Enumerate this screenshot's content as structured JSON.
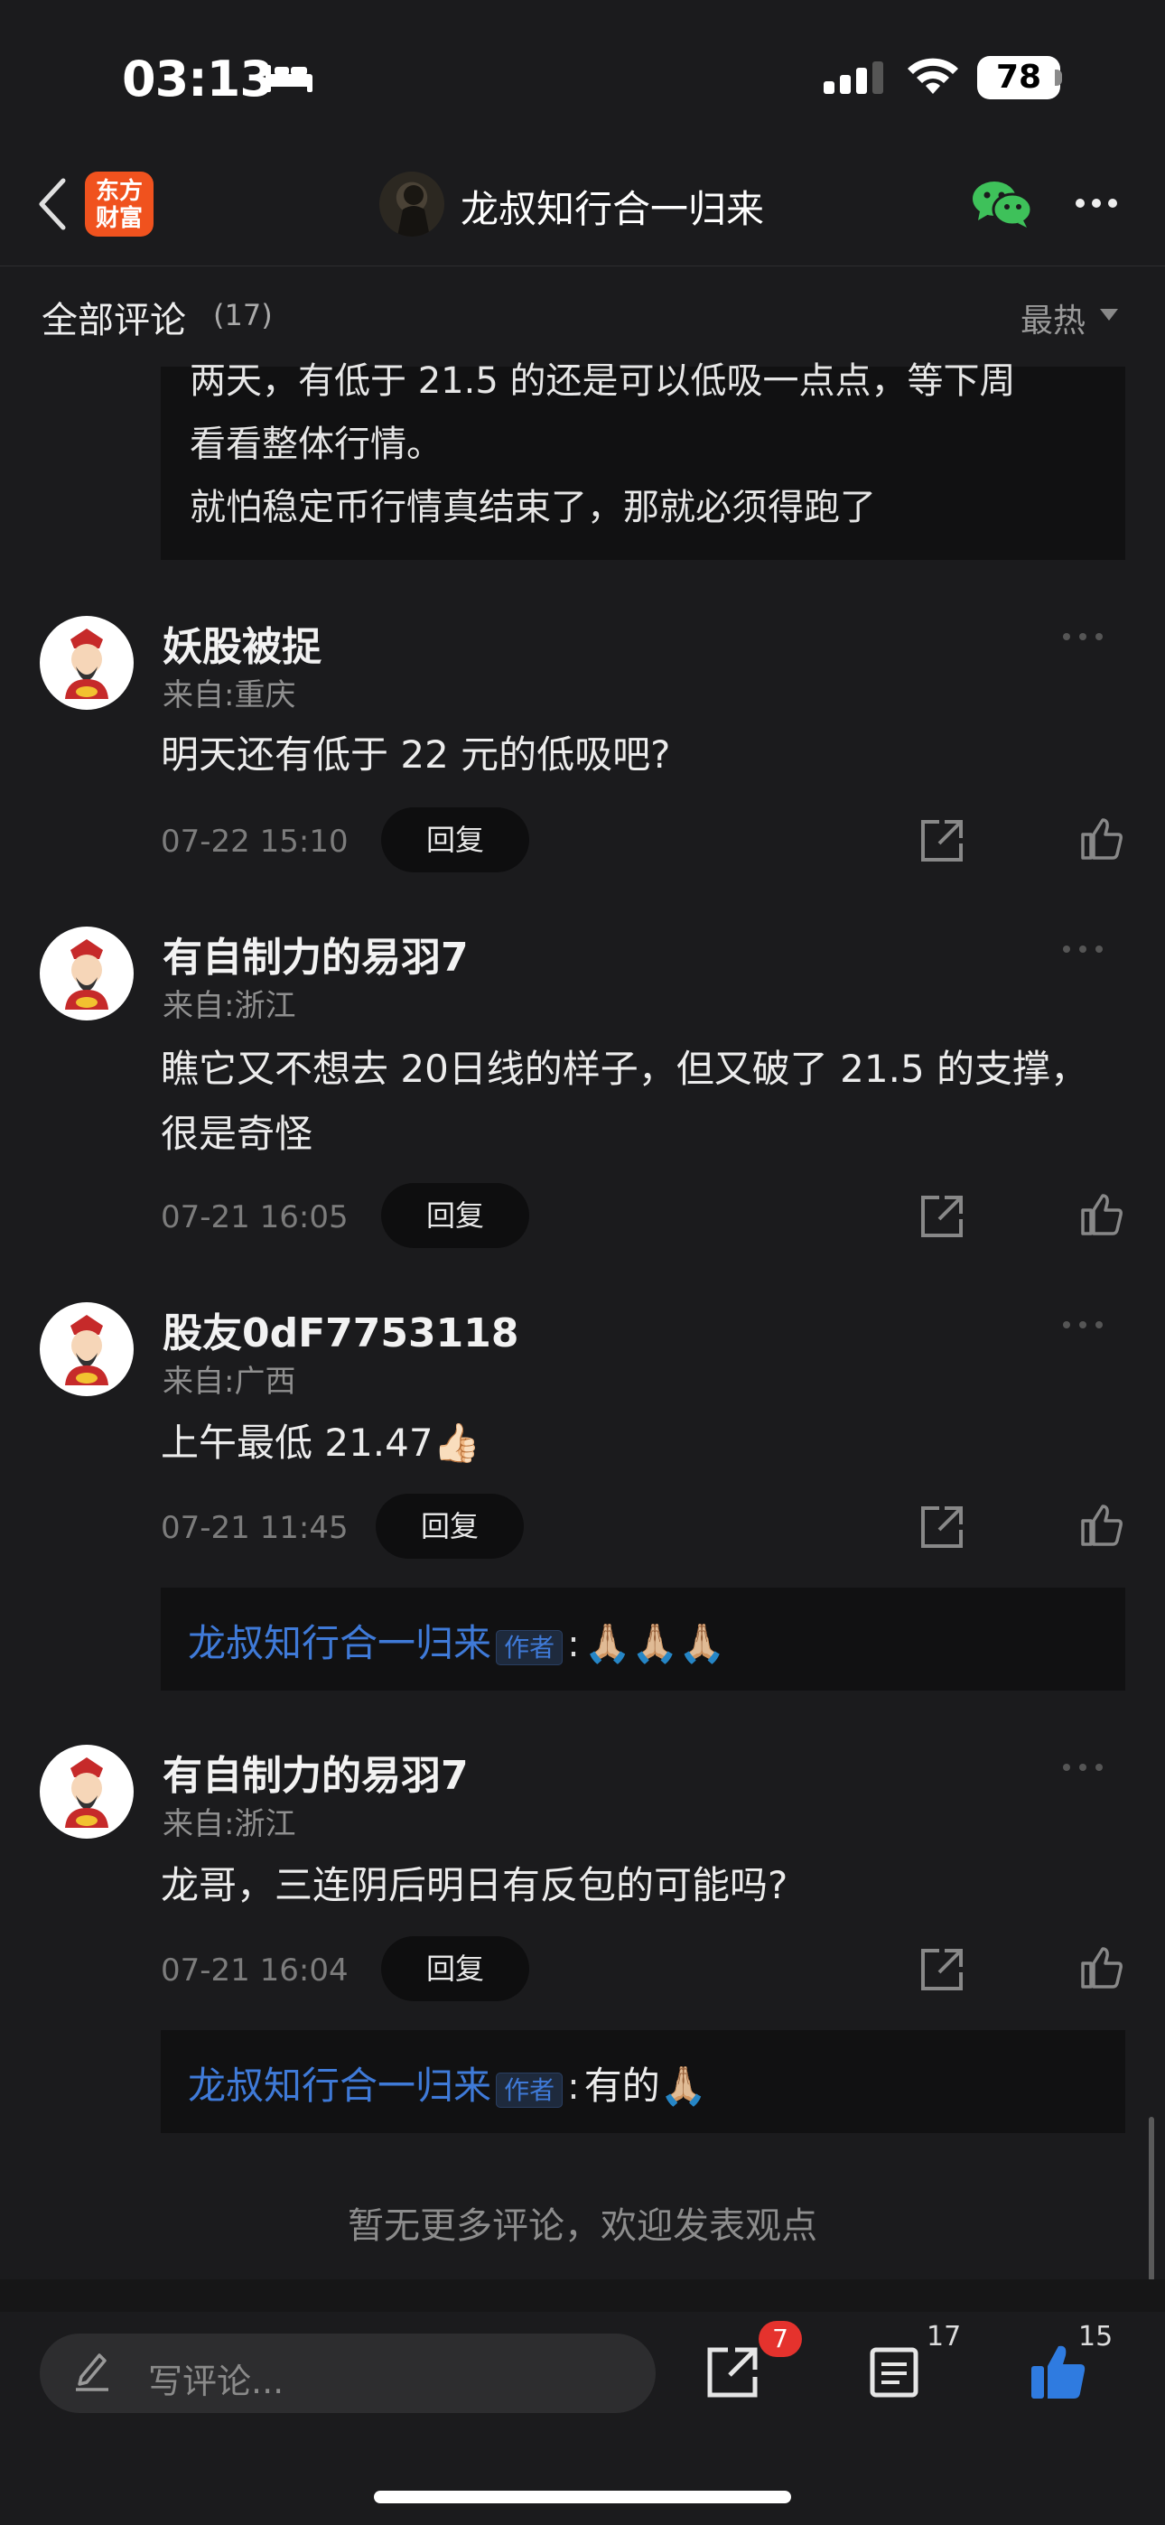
{
  "status": {
    "time": "03:13",
    "battery": "78"
  },
  "nav": {
    "logo_text": "东方\n财富",
    "title": "龙叔知行合一归来"
  },
  "header": {
    "title": "全部评论",
    "count": "(17)",
    "sort": "最热"
  },
  "quoted_top": {
    "lines": [
      "两天，有低于 21.5 的还是可以低吸一点点，等下周",
      "看看整体行情。",
      "就怕稳定币行情真结束了，那就必须得跑了"
    ]
  },
  "comments": [
    {
      "user": "妖股被捉",
      "location": "来自:重庆",
      "lines": [
        "明天还有低于 22 元的低吸吧?"
      ],
      "time": "07-22 15:10",
      "reply_label": "回复"
    },
    {
      "user": "有自制力的易羽7",
      "location": "来自:浙江",
      "lines": [
        "瞧它又不想去 20日线的样子，但又破了 21.5 的支撑，",
        "很是奇怪"
      ],
      "time": "07-21 16:05",
      "reply_label": "回复"
    },
    {
      "user": "股友0dF7753118",
      "location": "来自:广西",
      "lines": [
        "上午最低 21.47👍🏻"
      ],
      "time": "07-21 11:45",
      "reply_label": "回复",
      "reply": {
        "author": "龙叔知行合一归来",
        "tag": "作者",
        "text": "🙏🏼🙏🏼🙏🏼"
      }
    },
    {
      "user": "有自制力的易羽7",
      "location": "来自:浙江",
      "lines": [
        "龙哥，三连阴后明日有反包的可能吗?"
      ],
      "time": "07-21 16:04",
      "reply_label": "回复",
      "reply": {
        "author": "龙叔知行合一归来",
        "tag": "作者",
        "text": "有的🙏🏼"
      }
    }
  ],
  "end_text": "暂无更多评论，欢迎发表观点",
  "bottom": {
    "placeholder": "写评论...",
    "share_badge": "7",
    "comment_count": "17",
    "like_count": "15"
  },
  "colors": {
    "accent_blue": "#3f7ad8",
    "brand_orange": "#f0521e",
    "badge_red": "#e5322d",
    "like_blue": "#2f7be0"
  },
  "icons": [
    "back-icon",
    "bed-icon",
    "cellular-icon",
    "wifi-icon",
    "wechat-icon",
    "more-icon",
    "share-icon",
    "like-icon",
    "pen-icon",
    "list-icon"
  ]
}
